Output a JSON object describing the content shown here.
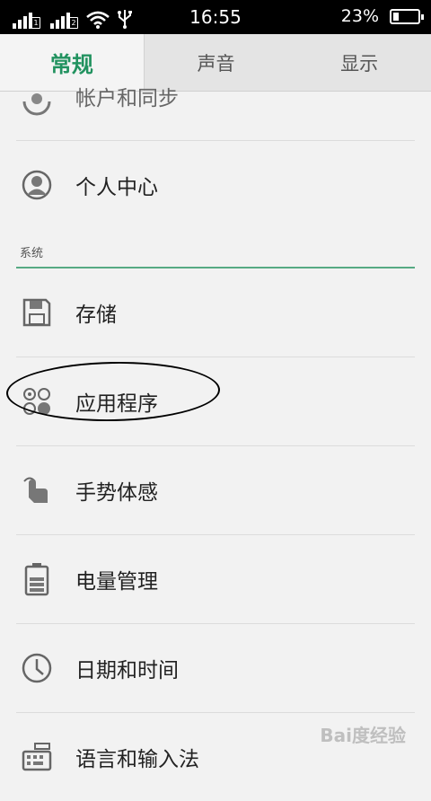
{
  "status_bar": {
    "sim1_label": "1",
    "sim2_label": "2",
    "time": "16:55",
    "battery_percent": "23%",
    "battery_level": 0.23
  },
  "tabs": [
    {
      "label": "常规",
      "active": true
    },
    {
      "label": "声音",
      "active": false
    },
    {
      "label": "显示",
      "active": false
    }
  ],
  "list": {
    "partial_item": {
      "label": "帐户和同步",
      "icon": "account-sync-icon"
    },
    "items_top": [
      {
        "label": "个人中心",
        "icon": "person-icon"
      }
    ],
    "section_title": "系统",
    "system_items": [
      {
        "label": "存储",
        "icon": "storage-icon"
      },
      {
        "label": "应用程序",
        "icon": "apps-icon"
      },
      {
        "label": "手势体感",
        "icon": "gesture-icon"
      },
      {
        "label": "电量管理",
        "icon": "battery-manage-icon"
      },
      {
        "label": "日期和时间",
        "icon": "clock-icon"
      },
      {
        "label": "语言和输入法",
        "icon": "keyboard-icon"
      }
    ]
  },
  "watermark": "Bai度经验",
  "colors": {
    "accent": "#21925f",
    "status_bar": "#000000",
    "background": "#f2f2f2"
  }
}
